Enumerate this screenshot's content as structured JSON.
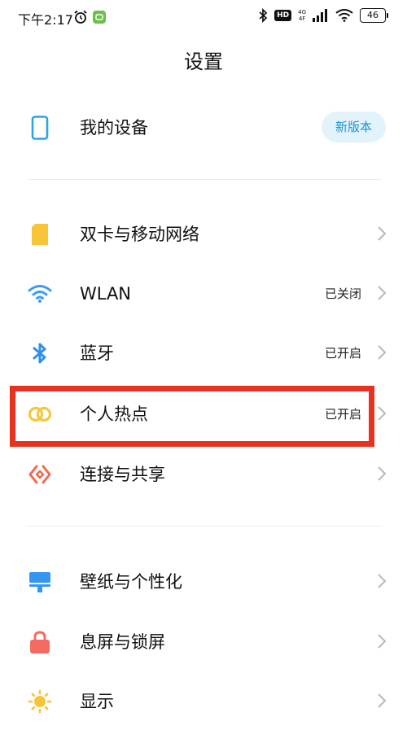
{
  "status_bar": {
    "time": "下午2:17",
    "hd": "HD",
    "net_top": "4G",
    "net_bottom": "4F",
    "battery": "46"
  },
  "header": {
    "title": "设置"
  },
  "device": {
    "label": "我的设备",
    "badge": "新版本"
  },
  "connectivity": [
    {
      "label": "双卡与移动网络",
      "status": "",
      "icon": "sim-card-icon"
    },
    {
      "label": "WLAN",
      "status": "已关闭",
      "icon": "wifi-icon"
    },
    {
      "label": "蓝牙",
      "status": "已开启",
      "icon": "bluetooth-icon"
    },
    {
      "label": "个人热点",
      "status": "已开启",
      "icon": "hotspot-icon"
    },
    {
      "label": "连接与共享",
      "status": "",
      "icon": "connection-share-icon"
    }
  ],
  "personalization": [
    {
      "label": "壁纸与个性化",
      "icon": "wallpaper-icon"
    },
    {
      "label": "息屏与锁屏",
      "icon": "lock-icon"
    },
    {
      "label": "显示",
      "icon": "display-sun-icon"
    }
  ],
  "colors": {
    "accent": "#1a94d6",
    "highlight": "#e8321f",
    "sim": "#f7c438",
    "wifi": "#3b9df0",
    "hotspot": "#f4c83c",
    "share": "#f06a4d",
    "wallpaper": "#3596f2",
    "lock": "#f56b5f",
    "sun": "#f7c438"
  }
}
